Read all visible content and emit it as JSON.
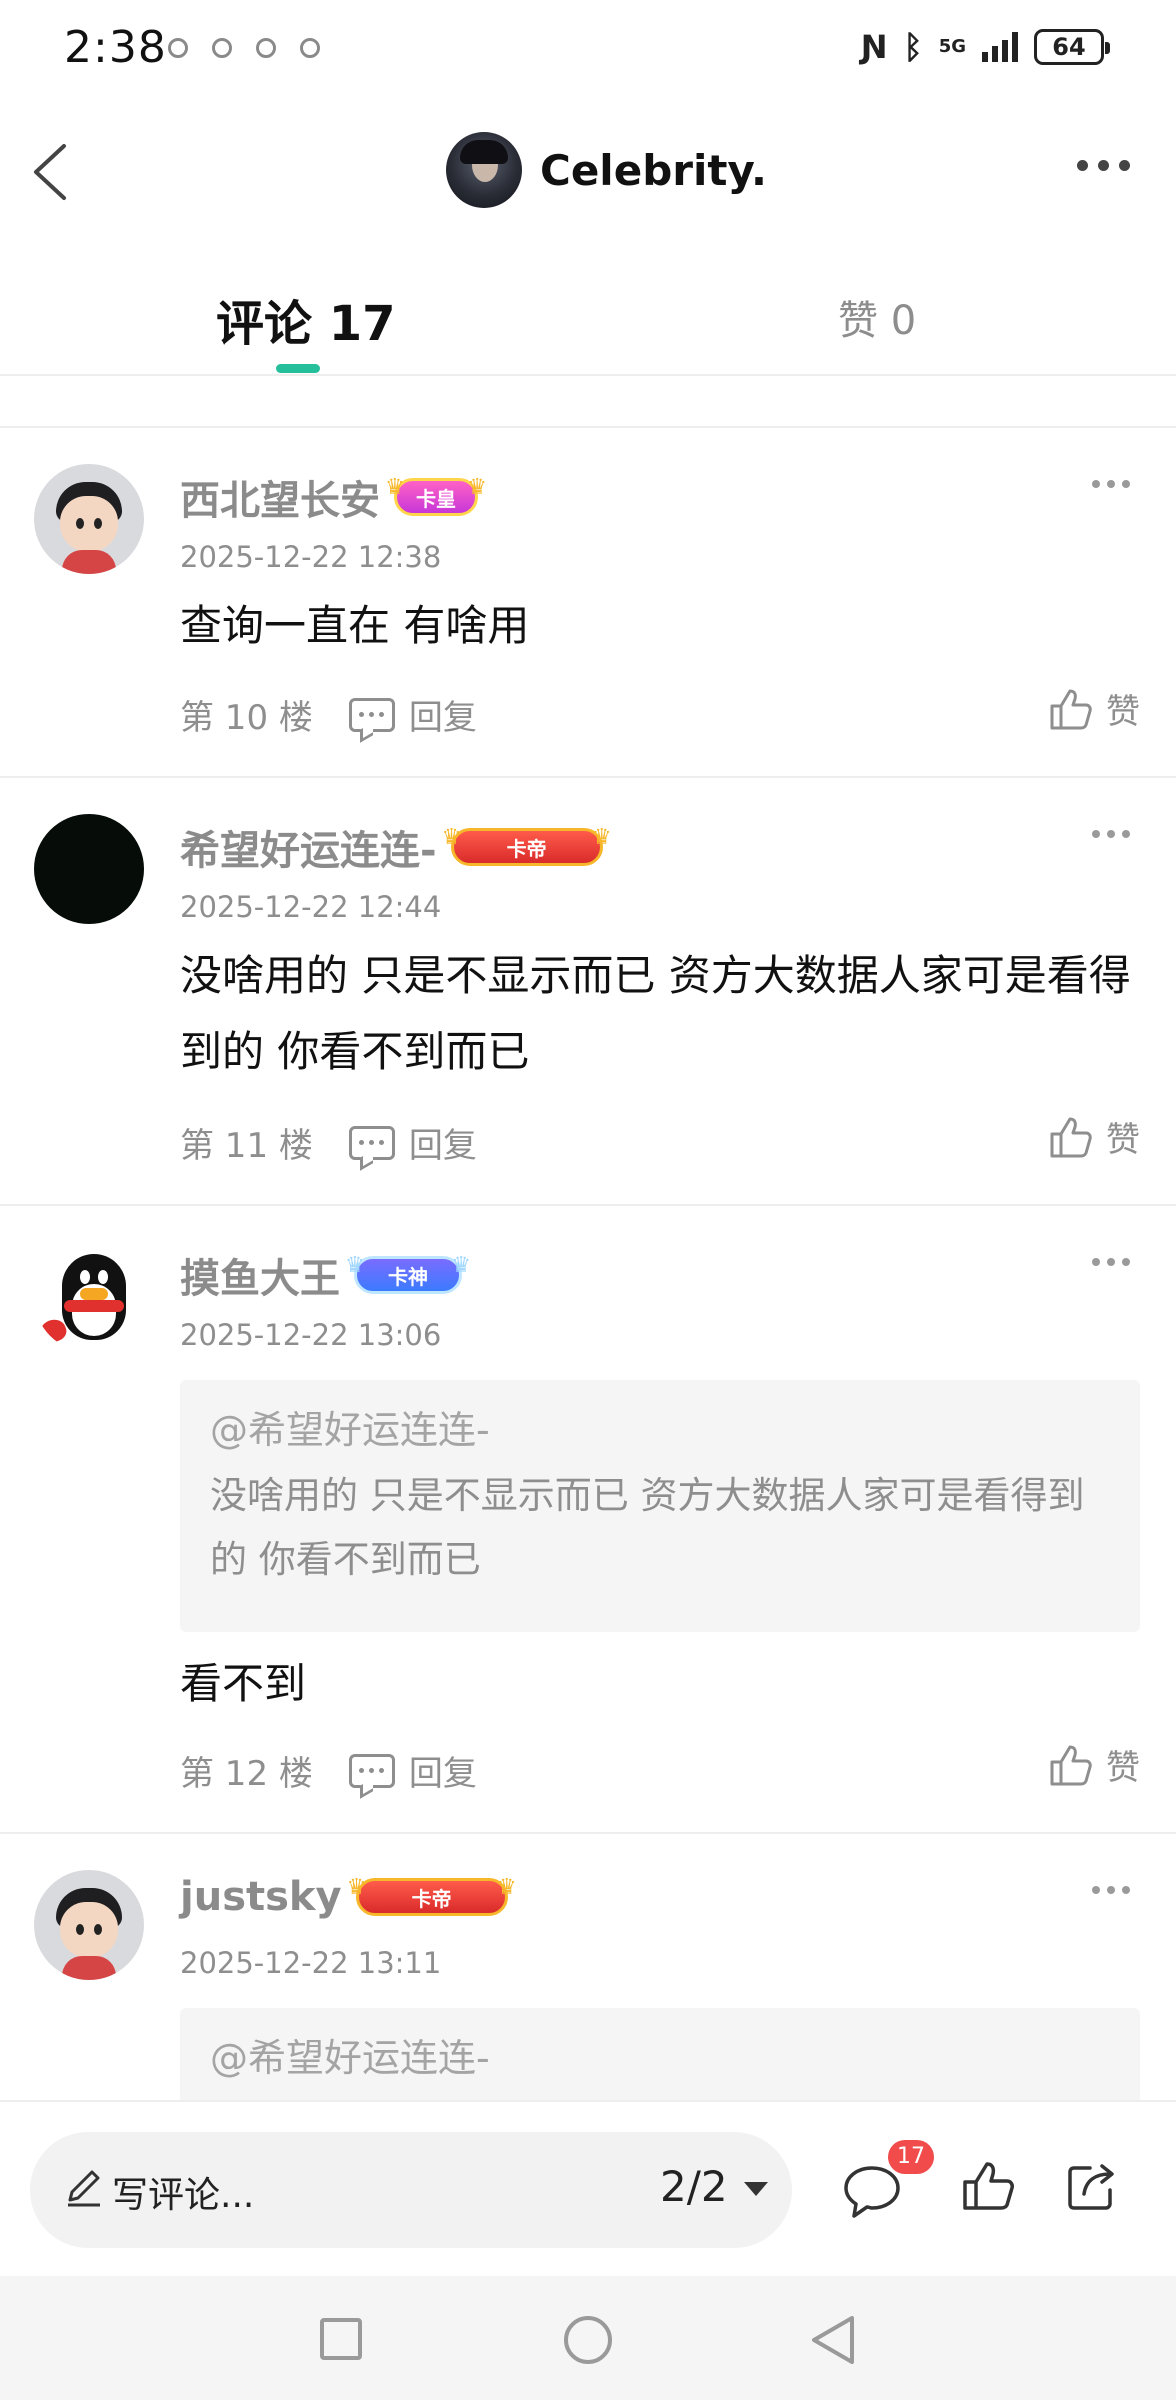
{
  "status_bar": {
    "time": "2:38",
    "network": "5G",
    "battery": "64"
  },
  "header": {
    "title": "Celebrity."
  },
  "tabs": {
    "comments_label": "评论 17",
    "likes_label": "赞 0"
  },
  "comments": [
    {
      "username": "西北望长安",
      "badge": "卡皇",
      "time": "2025-12-22 12:38",
      "text": "查询一直在  有啥用",
      "floor": "第 10 楼",
      "reply_label": "回复",
      "like_label": "赞"
    },
    {
      "username": "希望好运连连-",
      "badge": "卡帝",
      "time": "2025-12-22 12:44",
      "text": "没啥用的 只是不显示而已 资方大数据人家可是看得到的 你看不到而已",
      "floor": "第 11 楼",
      "reply_label": "回复",
      "like_label": "赞"
    },
    {
      "username": "摸鱼大王",
      "badge": "卡神",
      "time": "2025-12-22 13:06",
      "quote_user": "@希望好运连连-",
      "quote_text": "没啥用的 只是不显示而已 资方大数据人家可是看得到的 你看不到而已",
      "text": "看不到",
      "floor": "第 12 楼",
      "reply_label": "回复",
      "like_label": "赞"
    },
    {
      "username": "justsky",
      "badge": "卡帝",
      "time": "2025-12-22 13:11",
      "quote_user": "@希望好运连连-"
    }
  ],
  "bottom_bar": {
    "write_placeholder": "写评论...",
    "page_indicator": "2/2",
    "comment_count": "17"
  },
  "colors": {
    "accent": "#26bf9c",
    "badge_red": "#f24b4b"
  }
}
